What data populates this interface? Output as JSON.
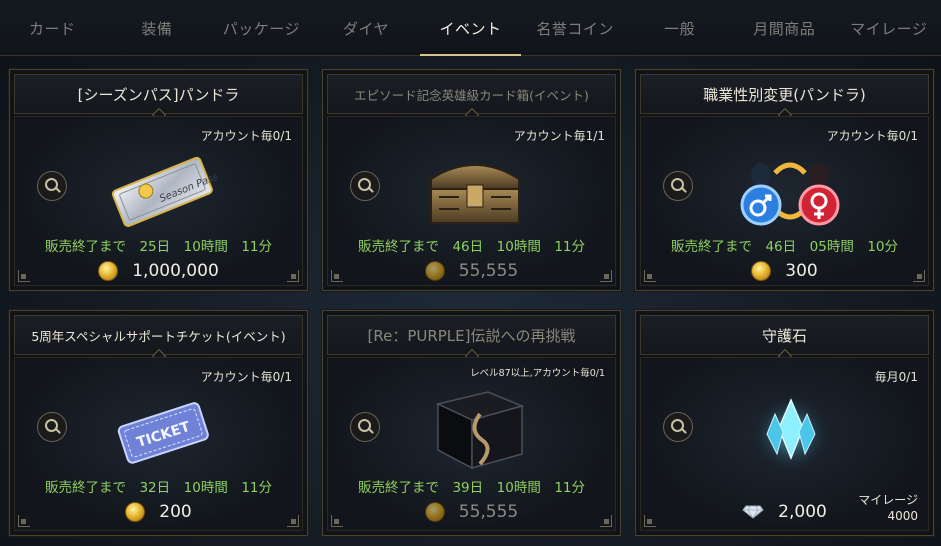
{
  "tabs": [
    {
      "label": "カード",
      "active": false
    },
    {
      "label": "装備",
      "active": false
    },
    {
      "label": "パッケージ",
      "active": false
    },
    {
      "label": "ダイヤ",
      "active": false
    },
    {
      "label": "イベント",
      "active": true
    },
    {
      "label": "名誉コイン",
      "active": false
    },
    {
      "label": "一般",
      "active": false
    },
    {
      "label": "月間商品",
      "active": false
    },
    {
      "label": "マイレージ",
      "active": false
    }
  ],
  "cards": [
    {
      "title": "[シーズンパス]パンドラ",
      "limit": "アカウント毎0/1",
      "timer": "販売終了まで　25日　10時間　11分",
      "price": "1,000,000",
      "currency": "gold-coin-icon",
      "icon": "season-pass-ticket-icon"
    },
    {
      "title": "エピソード記念英雄級カード箱(イベント)",
      "limit": "アカウント毎1/1",
      "timer": "販売終了まで　46日　10時間　11分",
      "price": "55,555",
      "currency": "gold-coin-icon",
      "icon": "treasure-chest-icon"
    },
    {
      "title": "職業性別変更(パンドラ)",
      "limit": "アカウント毎0/1",
      "timer": "販売終了まで　46日　05時間　10分",
      "price": "300",
      "currency": "gold-coin-icon",
      "icon": "gender-change-icon"
    },
    {
      "title": "5周年スペシャルサポートチケット(イベント)",
      "limit": "アカウント毎0/1",
      "timer": "販売終了まで　32日　10時間　11分",
      "price": "200",
      "currency": "gold-coin-icon",
      "icon": "ticket-icon"
    },
    {
      "title": "[Re：PURPLE]伝説への再挑戦",
      "limit": "レベル87以上,アカウント毎0/1",
      "timer": "販売終了まで　39日　10時間　11分",
      "price": "55,555",
      "currency": "gold-coin-icon",
      "icon": "dark-box-icon"
    },
    {
      "title": "守護石",
      "limit": "毎月0/1",
      "price": "2,000",
      "currency": "diamond-icon",
      "icon": "guardian-stone-icon",
      "mileage_label": "マイレージ",
      "mileage_value": "4000"
    }
  ]
}
